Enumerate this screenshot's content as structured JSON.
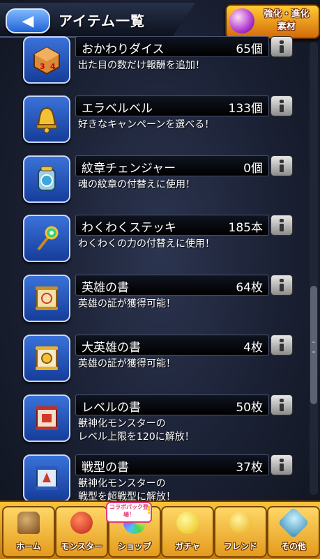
{
  "header": {
    "back_label": "◀",
    "title": "アイテム一覧",
    "enhance_label_1": "強化・進化",
    "enhance_label_2": "素材"
  },
  "items": [
    {
      "name": "おかわりダイス",
      "count": "65個",
      "desc_1": "出た目の数だけ報酬を追加！",
      "desc_2": "",
      "icon": "dice-icon"
    },
    {
      "name": "エラベルベル",
      "count": "133個",
      "desc_1": "好きなキャンペーンを選べる！",
      "desc_2": "",
      "icon": "bell-icon"
    },
    {
      "name": "紋章チェンジャー",
      "count": "0個",
      "desc_1": "魂の紋章の付替えに使用！",
      "desc_2": "",
      "icon": "emblem-changer-icon"
    },
    {
      "name": "わくわくステッキ",
      "count": "185本",
      "desc_1": "わくわくの力の付替えに使用！",
      "desc_2": "",
      "icon": "wand-icon"
    },
    {
      "name": "英雄の書",
      "count": "64枚",
      "desc_1": "英雄の証が獲得可能！",
      "desc_2": "",
      "icon": "scroll-icon"
    },
    {
      "name": "大英雄の書",
      "count": "4枚",
      "desc_1": "英雄の証が獲得可能！",
      "desc_2": "",
      "icon": "gold-scroll-icon"
    },
    {
      "name": "レベルの書",
      "count": "50枚",
      "desc_1": "獣神化モンスターの",
      "desc_2": "レベル上限を120に解放！",
      "icon": "level-scroll-icon"
    },
    {
      "name": "戦型の書",
      "count": "37枚",
      "desc_1": "獣神化モンスターの",
      "desc_2": "戦型を超戦型に解放！",
      "icon": "battle-scroll-icon"
    }
  ],
  "nav": [
    {
      "label": "ホーム",
      "icon": "home-icon"
    },
    {
      "label": "モンスター",
      "icon": "monster-icon"
    },
    {
      "label": "ショップ",
      "icon": "shop-icon"
    },
    {
      "label": "ガチャ",
      "icon": "gacha-icon"
    },
    {
      "label": "フレンド",
      "icon": "friend-icon"
    },
    {
      "label": "その他",
      "icon": "other-icon"
    }
  ],
  "shop_badge": "コラボパック登場！",
  "colors": {
    "accent_blue": "#1f63d6",
    "nav_gold": "#f8c33a"
  }
}
